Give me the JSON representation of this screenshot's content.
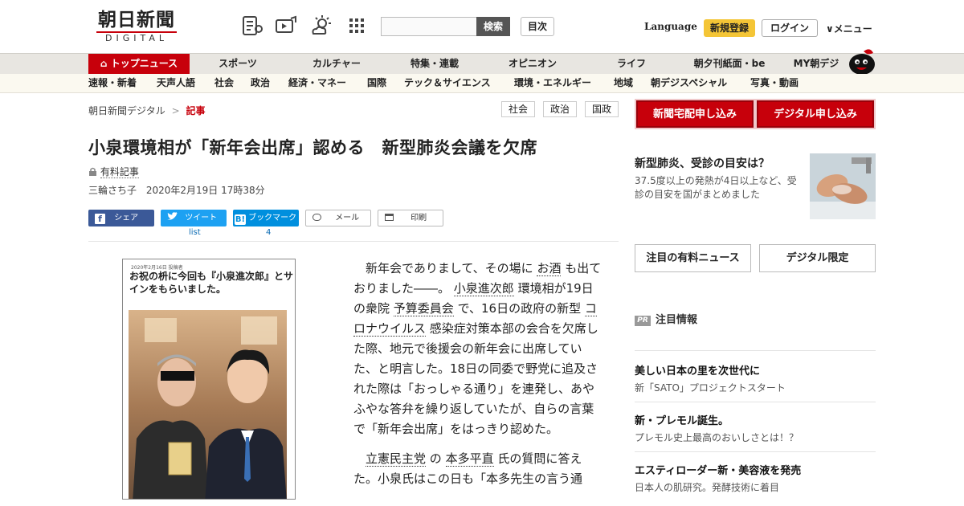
{
  "header": {
    "logo_kanji": "朝日新聞",
    "logo_sub": "DIGITAL",
    "search_button": "検索",
    "index_button": "目次",
    "language": "Language",
    "signup": "新規登録",
    "login": "ログイン",
    "menu": "メニュー"
  },
  "nav_primary": [
    "トップニュース",
    "スポーツ",
    "カルチャー",
    "特集・連載",
    "オピニオン",
    "ライフ",
    "朝夕刊紙面・be",
    "MY朝デジ"
  ],
  "nav_secondary": [
    "速報・新着",
    "天声人語",
    "社会",
    "政治",
    "経済・マネー",
    "国際",
    "テック＆サイエンス",
    "環境・エネルギー",
    "地域",
    "朝デジスペシャル",
    "写真・動画"
  ],
  "breadcrumb": {
    "home": "朝日新聞デジタル",
    "sep": ">",
    "current": "記事"
  },
  "tags": [
    "社会",
    "政治",
    "国政"
  ],
  "article": {
    "title": "小泉環境相が「新年会出席」認める　新型肺炎会議を欠席",
    "paid_label": "有料記事",
    "author": "三輪さち子",
    "date": "2020年2月19日 17時38分"
  },
  "share": {
    "facebook": "シェア",
    "twitter": "ツイート",
    "twitter_count": "list",
    "hatena": "ブックマーク",
    "hatena_count": "4",
    "mail": "メール",
    "print": "印刷"
  },
  "photo": {
    "small_caption": "2020年2月16日 投稿者",
    "caption": "お祝の枡に今回も『小泉進次郎』とサインをもらいました。"
  },
  "body": {
    "p1": [
      "新年会でありまして、その場に",
      "お酒",
      "も出ておりました――。",
      "小泉進次郎",
      "環境相が19日の衆院",
      "予算委員会",
      "で、16日の政府の新型",
      "コロナウイルス",
      "感染症対策本部の会合を欠席した際、地元で後援会の新年会に出席していた、と明言した。18日の同委で野党に追及された際は「おっしゃる通り」を連発し、あやふやな答弁を繰り返していたが、自らの言葉で「新年会出席」をはっきり認めた。"
    ],
    "p2": [
      "立憲民主党",
      "の",
      "本多平直",
      "氏の質問に答えた。小泉氏はこの日も「本多先生の言う通"
    ]
  },
  "sidebar": {
    "cta_delivery": "新聞宅配申し込み",
    "cta_digital": "デジタル申し込み",
    "promo_title": "新型肺炎、受診の目安は？",
    "promo_desc": "37.5度以上の発熱が4日以上など、受診の目安を国がまとめました",
    "btn_paid_news": "注目の有料ニュース",
    "btn_digital_only": "デジタル限定",
    "pr_badge": "PR",
    "pr_heading": "注目情報",
    "pr_items": [
      {
        "title": "美しい日本の里を次世代に",
        "desc": "新「SATO」プロジェクトスタート"
      },
      {
        "title": "新・プレモル誕生。",
        "desc": "プレモル史上最高のおいしさとは！？"
      },
      {
        "title": "エスティローダー新・美容液を発売",
        "desc": "日本人の肌研究。発酵技術に着目"
      }
    ]
  },
  "colors": {
    "brand_red": "#c7000b",
    "signup_yellow": "#f4c536"
  }
}
